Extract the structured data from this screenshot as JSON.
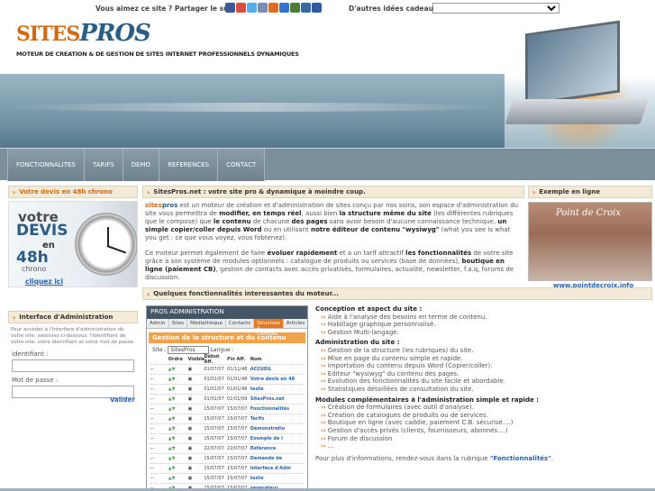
{
  "topbar": {
    "ask": "Vous aimez ce site ? Partager le sur...",
    "share_icons": [
      {
        "name": "facebook-icon",
        "color": "#3b5998"
      },
      {
        "name": "google-icon",
        "color": "#dd4b39"
      },
      {
        "name": "twitter-icon",
        "color": "#55acee"
      },
      {
        "name": "myspace-icon",
        "color": "#7a8db2"
      },
      {
        "name": "msn-icon",
        "color": "#e06c1c"
      },
      {
        "name": "delicious-icon",
        "color": "#3274d1"
      },
      {
        "name": "blog-icon",
        "color": "#4b7d3a"
      },
      {
        "name": "digg-icon",
        "color": "#356aa0"
      },
      {
        "name": "favorite-icon",
        "color": "#2d5d9f"
      }
    ],
    "ideas_label": "D'autres idées cadeaux :",
    "ideas_value": ""
  },
  "header": {
    "logo_sites": "SITES",
    "logo_pros": "PROS",
    "tagline": "MOTEUR DE CREATION & DE GESTION DE SITES INTERNET PROFESSIONNELS DYNAMIQUES"
  },
  "nav": [
    "FONCTIONNALITES",
    "TARIFS",
    "DEMO",
    "REFERENCES",
    "CONTACT"
  ],
  "left": {
    "devis_title": "Votre devis en 48h chrono",
    "devis_img": {
      "line1": "votre",
      "line2": "DEVIS",
      "line3": "en",
      "line4": "48h",
      "line5": "chrono",
      "link": "cliquez ici"
    },
    "admin_title": "Interface d'Administration",
    "admin_text": "Pour accéder à l'interface d'administration de votre site, saisissez ci-dessous, l'identifiant de votre site, votre identifiant et votre mot de passe.",
    "id_label": "Identifiant :",
    "pw_label": "Mot de passe :",
    "submit": "Valider"
  },
  "center": {
    "title": "SitesPros.net : votre site pro & dynamique à moindre coup.",
    "p1": {
      "brand_a": "sites",
      "brand_b": "pros",
      "t1": " est un moteur de création et d'administration de sites conçu par nos soins, son espace d'administration du site vous permettra de ",
      "b1": "modifier, en temps réel",
      "t2": ", aussi bien ",
      "b2": "la structure même du site",
      "t3": " (les différentes rubriques que le compose) que ",
      "b3": "le contenu",
      "t4": " de chacune ",
      "b4": "des pages",
      "t5": " sans avoir besoin d'aucune connaissance technique, ",
      "b5": "un simple copier/coller depuis Word",
      "t6": " ou en utilisant ",
      "b6": "notre éditeur de contenu \"wysiwyg\"",
      "t7": " (what you see is what you get : ce que vous voyez, vous fobtenez)."
    },
    "p2": {
      "t1": "Ce moteur permet également de faire ",
      "b1": "évoluer rapidement",
      "t2": " et a un tarif attractif ",
      "b2": "les fonctionnalités",
      "t3": " de votre site grâce à son système de modules optionnels : catalogue de produits ou services (base de données), ",
      "b3": "boutique en ligne (paiement CB)",
      "t4": ", gestion de contacts avec accès privatisés, formulaires, actualité, newsletter, f.a.q, forums de discussion."
    }
  },
  "right": {
    "title": "Exemple en ligne",
    "img_title": "Point de Croix",
    "url": "www.pointdecroix.info"
  },
  "features": {
    "title": "Quelques fonctionnalités interessantes du moteur...",
    "screenshot": {
      "bar": "PROS ADMINISTRATION",
      "tabs": [
        "Admin",
        "Sites",
        "Médiathèque",
        "Contacts",
        "Structure & Contenu",
        "Articles",
        "F"
      ],
      "heading": "Gestion de la structure et du contenu",
      "site_label": "Site :",
      "site_value": "SitesPros",
      "langue": "Langue :",
      "cols": [
        "Ordre",
        "Visible",
        "Début Aff.",
        "Fin Aff.",
        "Nom"
      ],
      "rows": [
        [
          "",
          "",
          "01/07/07",
          "01/11/48",
          "ACCUEIL"
        ],
        [
          "",
          "",
          "01/01/07",
          "01/01/48",
          "Votre devis en 48"
        ],
        [
          "",
          "",
          "01/01/07",
          "01/01/48",
          "texte"
        ],
        [
          "",
          "",
          "01/01/07",
          "01/01/09",
          "SitesPros.net"
        ],
        [
          "",
          "",
          "15/07/07",
          "15/07/07",
          "Fonctionnalités"
        ],
        [
          "",
          "",
          "15/07/07",
          "15/07/07",
          "Tarifs"
        ],
        [
          "",
          "",
          "15/07/07",
          "15/07/07",
          "Démonstratio"
        ],
        [
          "",
          "",
          "15/07/07",
          "15/07/07",
          "Exemple de l"
        ],
        [
          "",
          "",
          "22/07/07",
          "22/07/07",
          "Référence"
        ],
        [
          "",
          "",
          "15/07/07",
          "15/07/07",
          "Demande de"
        ],
        [
          "",
          "",
          "15/07/07",
          "15/07/07",
          "Interface d'Adm"
        ],
        [
          "",
          "",
          "15/07/07",
          "15/07/07",
          "texte"
        ],
        [
          "",
          "",
          "15/07/07",
          "15/07/07",
          "separateur"
        ]
      ]
    },
    "sections": [
      {
        "title": "Conception et aspect du site :",
        "items": [
          "Aide à l'analyse des besoins en terme de contenu.",
          "Habillage graphique personnalisé.",
          "Gestion Multi-langage."
        ]
      },
      {
        "title": "Administration du site :",
        "items": [
          "Gestion de la structure (les rubriques) du site.",
          "Mise en page du contenu simple et rapide.",
          "Importation du contenu depuis Word (Copier/coller).",
          "Editeur \"wysiwyg\" du contenu des pages.",
          "Evolution des fonctionnalités du site facile et abordable.",
          "Statistiques détaillées de consultation du site."
        ]
      },
      {
        "title": "Modules complémentaires à l'administration simple et rapide :",
        "items": [
          "Création de formulaires (avec outil d'analyse).",
          "Création de catalogues de produits ou de services.",
          "Boutique en ligne (avec caddie, paiement C.B. sécurisé....)",
          "Gestion d'accès privés (clients, fournisseurs, abonnés....)",
          "Forum de discussion",
          "..."
        ]
      }
    ],
    "more_text": "Pour plus d'informations, rendez-vous dans la rubrique ",
    "more_link": "\"Fonctionnalités\"",
    "more_end": "."
  }
}
